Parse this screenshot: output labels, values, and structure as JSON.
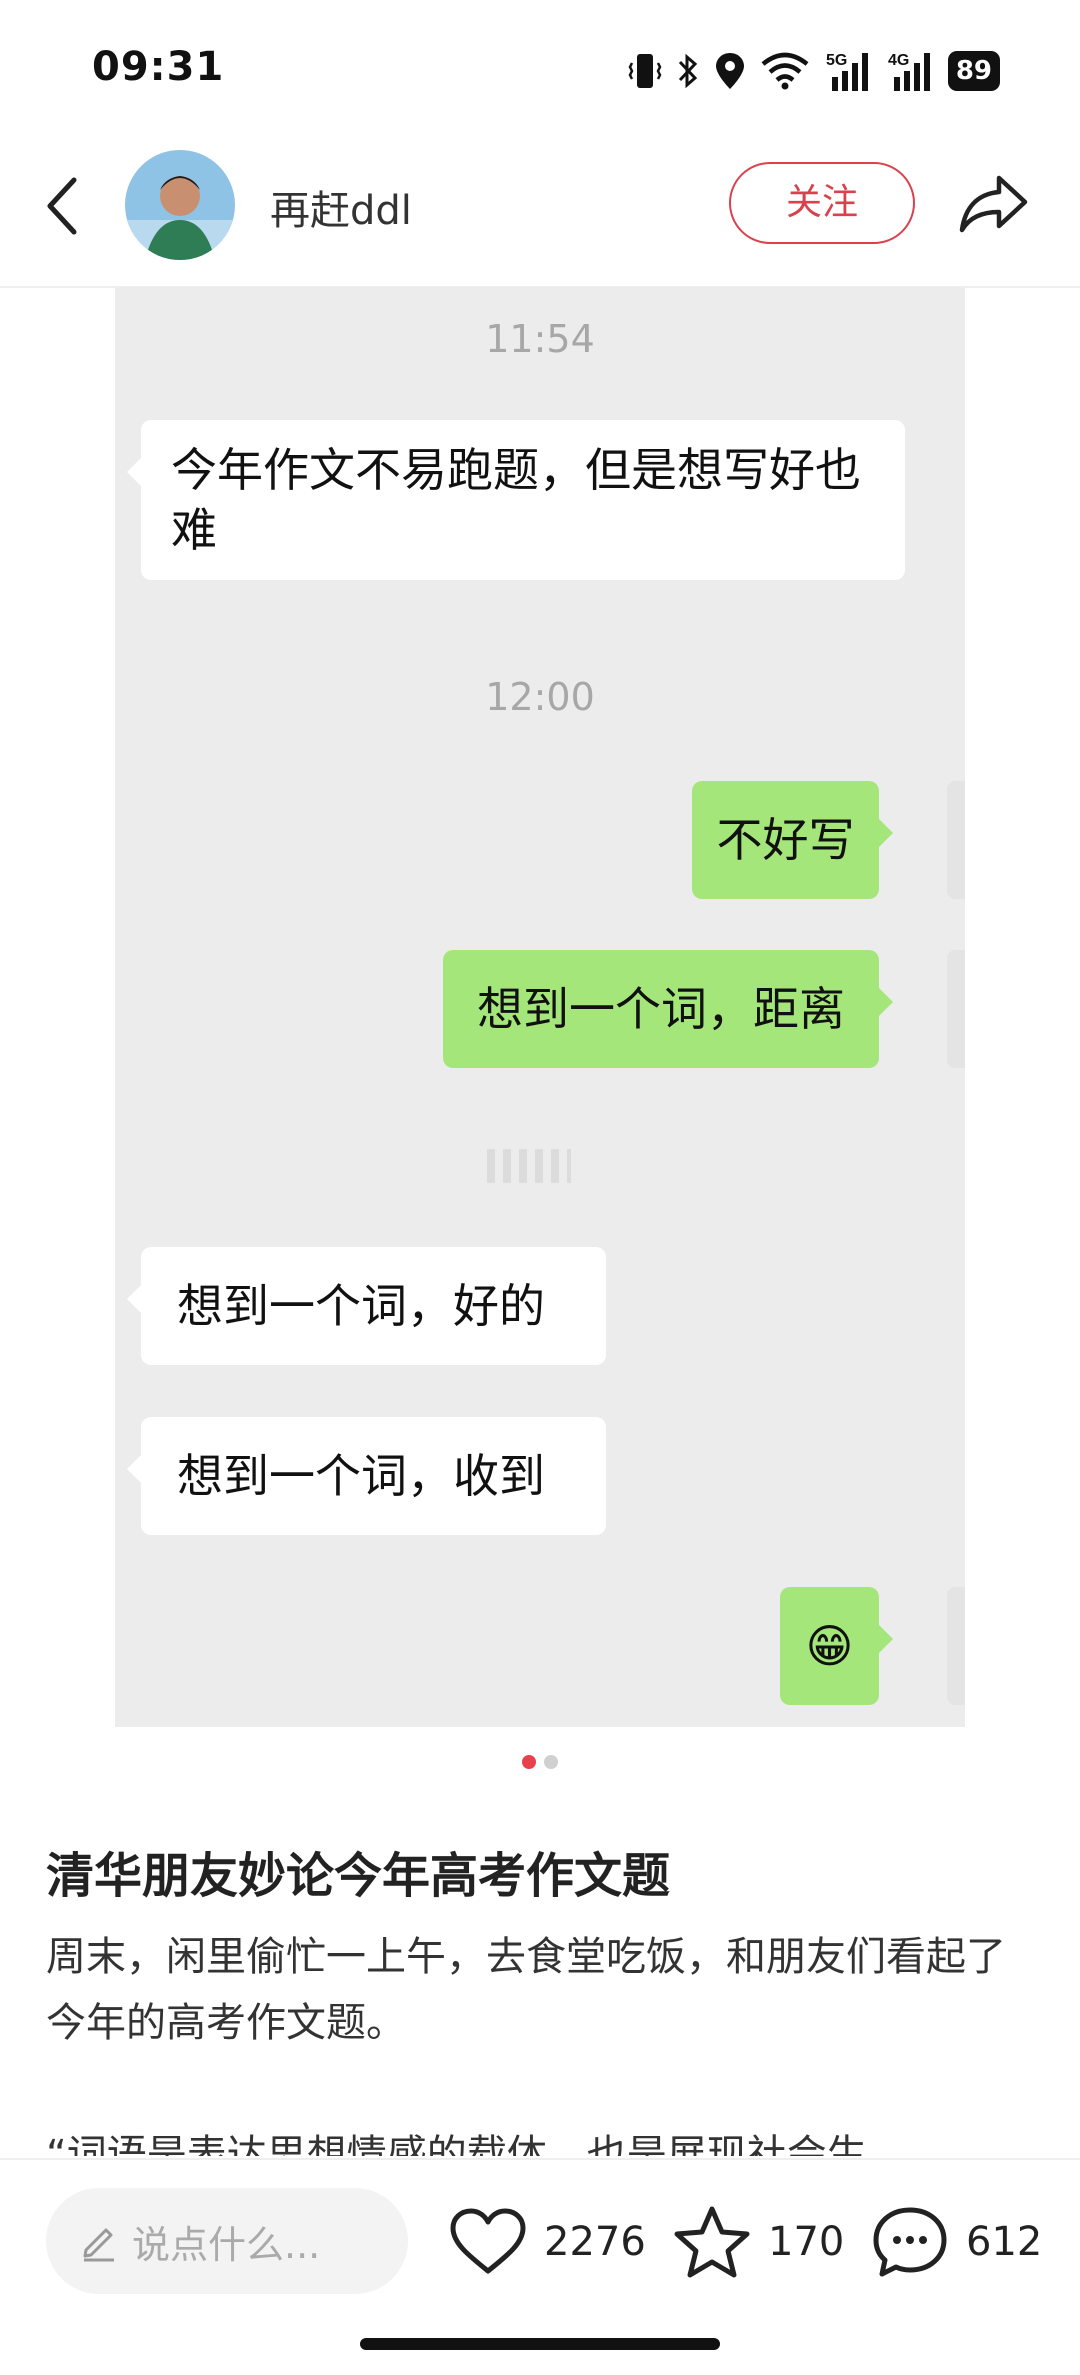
{
  "status_bar": {
    "time": "09:31",
    "battery": "89",
    "net1": "5G",
    "net2": "4G"
  },
  "header": {
    "author_name": "再赶ddl",
    "follow_label": "关注"
  },
  "chat": {
    "time1": "11:54",
    "msg1": "今年作文不易跑题，但是想写好也难",
    "time2": "12:00",
    "msg2": "不好写",
    "msg3": "想到一个词，距离",
    "msg4": "想到一个词，好的",
    "msg5": "想到一个词，收到",
    "msg6": "😁"
  },
  "carousel": {
    "pages": 2,
    "current": 1
  },
  "article": {
    "title": "清华朋友妙论今年高考作文题",
    "body": "周末，闲里偷忙一上午，去食堂吃饭，和朋友们看起了今年的高考作文题。",
    "quote_partial": "“词语是表达思想情感的载体，也是展现社会生"
  },
  "bottom_bar": {
    "comment_placeholder": "说点什么...",
    "likes": "2276",
    "favorites": "170",
    "comments": "612"
  },
  "colors": {
    "accent": "#d9424d",
    "chat_bg": "#ececec",
    "my_bubble": "#a5e67b"
  }
}
